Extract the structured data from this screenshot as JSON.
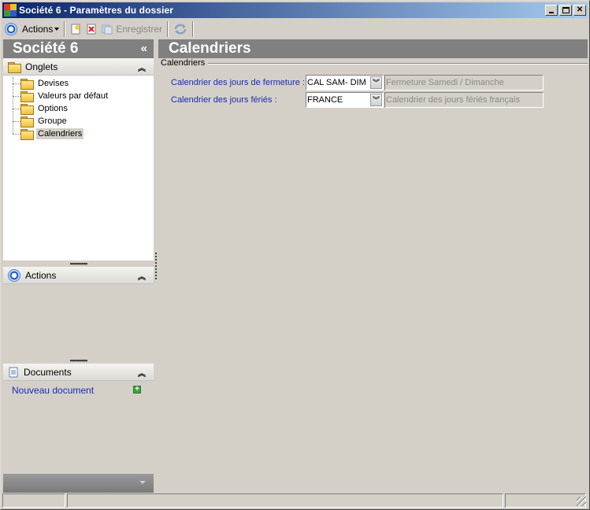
{
  "window": {
    "title": "Société 6 -  Paramètres du dossier",
    "controls": [
      "minimize",
      "maximize",
      "close"
    ]
  },
  "toolbar": {
    "actions_label": "Actions",
    "save_label": "Enregistrer",
    "icons": [
      "actions-circle-icon",
      "new-document-icon",
      "delete-icon",
      "save-icon",
      "refresh-icon"
    ]
  },
  "left_panel": {
    "title": "Société 6",
    "collapse_glyph": "«",
    "sections": {
      "onglets": {
        "label": "Onglets",
        "items": [
          {
            "label": "Devises",
            "selected": false
          },
          {
            "label": "Valeurs par défaut",
            "selected": false
          },
          {
            "label": "Options",
            "selected": false
          },
          {
            "label": "Groupe",
            "selected": false
          },
          {
            "label": "Calendriers",
            "selected": true
          }
        ]
      },
      "actions": {
        "label": "Actions"
      },
      "documents": {
        "label": "Documents",
        "new_document_label": "Nouveau document"
      }
    }
  },
  "main": {
    "title": "Calendriers",
    "group_label": "Calendriers",
    "fields": [
      {
        "label": "Calendrier des jours de fermeture :",
        "value": "CAL SAM- DIM",
        "description": "Fermeture Samedi / Dimanche"
      },
      {
        "label": "Calendrier des jours fériés :",
        "value": "FRANCE",
        "description": "Calendrier des jours fériés français"
      }
    ]
  },
  "colors": {
    "titlebar_start": "#0a246a",
    "titlebar_end": "#a6caf0",
    "panel_header": "#808080",
    "field_label": "#1a2bb0",
    "background": "#d4d0c8"
  }
}
